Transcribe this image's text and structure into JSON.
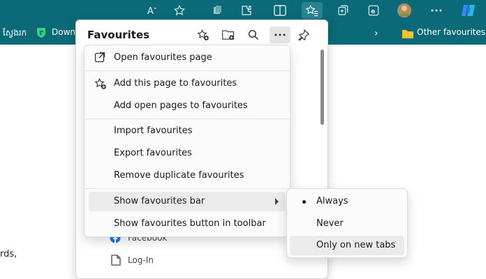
{
  "toolbar": {
    "icons": [
      "read-aloud-icon",
      "favourite-star-icon",
      "collections-icon",
      "extensions-icon",
      "split-screen-icon",
      "favourites-icon",
      "collections-add-icon",
      "edge-icon",
      "profile-avatar-icon",
      "more-icon",
      "copilot-icon"
    ]
  },
  "favourites_bar": {
    "item1": "ស្វែងរក",
    "item2": "Down",
    "other_favourites": "Other favourites"
  },
  "page": {
    "fragment": "rds,"
  },
  "panel": {
    "title": "Favourites",
    "items": [
      {
        "label": "Facebook",
        "icon": "facebook-icon"
      },
      {
        "label": "Log-In",
        "icon": "document-icon"
      }
    ]
  },
  "menu": {
    "items": [
      {
        "label": "Open favourites page",
        "icon": "open-external-icon"
      },
      {
        "label": "Add this page to favourites",
        "icon": "star-add-icon"
      },
      {
        "label": "Add open pages to favourites"
      },
      {
        "label": "Import favourites"
      },
      {
        "label": "Export favourites"
      },
      {
        "label": "Remove duplicate favourites"
      },
      {
        "label": "Show favourites bar",
        "submenu": true
      },
      {
        "label": "Show favourites button in toolbar"
      }
    ]
  },
  "submenu": {
    "items": [
      {
        "label": "Always",
        "selected": true
      },
      {
        "label": "Never"
      },
      {
        "label": "Only on new tabs"
      }
    ]
  },
  "colors": {
    "toolbar_bg": "#0b6a77",
    "menu_highlight": "#ebebeb"
  }
}
